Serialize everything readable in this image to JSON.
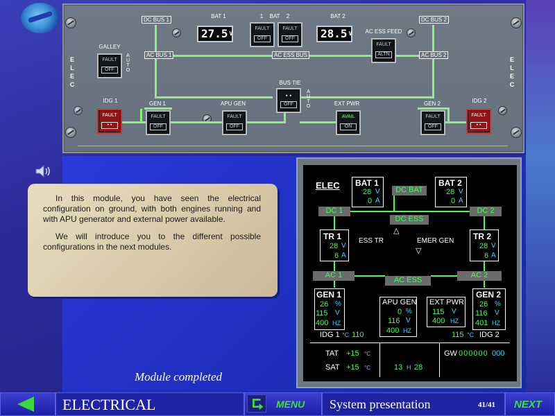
{
  "panel": {
    "elec_label": "ELEC",
    "galley_label": "GALLEY",
    "auto_label": "AUTO",
    "bat1_label": "BAT 1",
    "bat2_label": "BAT 2",
    "bat_sw_label_1": "1",
    "bat_sw_label_bat": "BAT",
    "bat_sw_label_2": "2",
    "bat1_voltage": "27.5",
    "bat2_voltage": "28.5",
    "volt_unit": "V",
    "dc_bus1": "DC BUS 1",
    "dc_bus2": "DC BUS 2",
    "ac_bus1": "AC BUS 1",
    "ac_bus2": "AC BUS 2",
    "ac_ess_bus": "AC ESS BUS",
    "ac_ess_feed": "AC ESS FEED",
    "bus_tie": "BUS TIE",
    "idg1": "IDG 1",
    "idg2": "IDG 2",
    "gen1": "GEN 1",
    "gen2": "GEN 2",
    "apu_gen": "APU GEN",
    "ext_pwr": "EXT PWR",
    "fault": "FAULT",
    "off": "OFF",
    "altn": "ALTN",
    "avail": "AVAIL",
    "on": "ON"
  },
  "note": {
    "para1": "In this module, you have seen the electrical configuration on ground, with both engines running and with APU generator and external power available.",
    "para2": "We will introduce you to the different possible configurations in the next modules.",
    "completed": "Module completed"
  },
  "ecam": {
    "title": "ELEC",
    "bat1": {
      "label": "BAT 1",
      "volt": "28",
      "amp": "0"
    },
    "bat2": {
      "label": "BAT 2",
      "volt": "28",
      "amp": "0"
    },
    "dc_bat": "DC BAT",
    "dc1": "DC 1",
    "dc2": "DC 2",
    "dc_ess": "DC ESS",
    "tr1": {
      "label": "TR 1",
      "volt": "28",
      "amp": "6"
    },
    "tr2": {
      "label": "TR 2",
      "volt": "28",
      "amp": "6"
    },
    "ess_tr": "ESS TR",
    "emer_gen": "EMER GEN",
    "ac1": "AC 1",
    "ac2": "AC 2",
    "ac_ess": "AC ESS",
    "gen1": {
      "label": "GEN 1",
      "pct": "26",
      "volt": "115",
      "hz": "400"
    },
    "gen2": {
      "label": "GEN 2",
      "pct": "26",
      "volt": "116",
      "hz": "401"
    },
    "apu_gen": {
      "label": "APU GEN",
      "pct": "0",
      "volt": "116",
      "hz": "400"
    },
    "ext_pwr": {
      "label": "EXT PWR",
      "volt": "115",
      "hz": "400"
    },
    "idg1": {
      "label": "IDG 1",
      "temp": "110"
    },
    "idg2": {
      "label": "IDG 2",
      "temp": "115"
    },
    "units": {
      "v": "V",
      "a": "A",
      "pct": "%",
      "hz": "HZ",
      "c": "°C"
    },
    "tat_label": "TAT",
    "tat_value": "+15",
    "sat_label": "SAT",
    "sat_value": "+15",
    "time_h": "13",
    "time_h_label": "H",
    "time_m": "28",
    "gw_label": "GW",
    "gw_value": "000000",
    "gw_unit": "000"
  },
  "nav": {
    "section": "ELECTRICAL",
    "menu": "MENU",
    "system": "System presentation",
    "page": "41/41",
    "next": "NEXT"
  }
}
